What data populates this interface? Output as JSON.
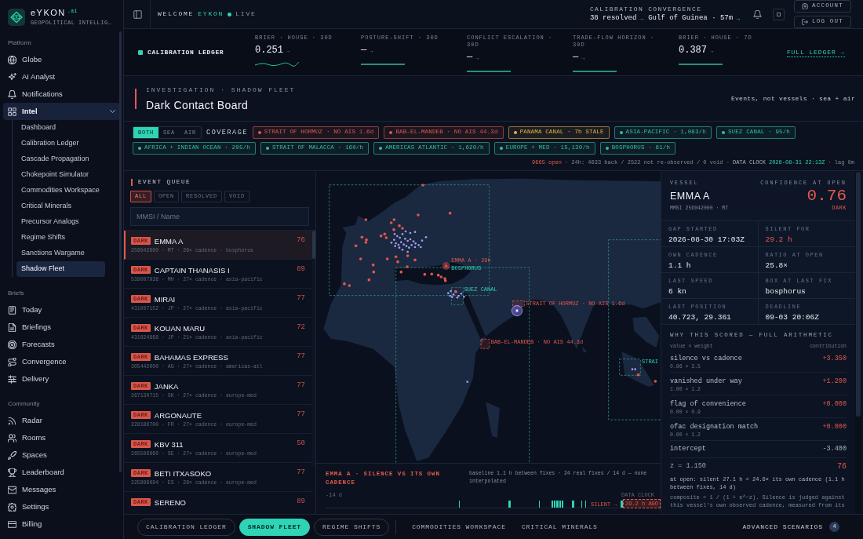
{
  "sidebar": {
    "brand": "eYKON",
    "brand_suffix": ".ai",
    "tagline": "GEOPOLITICAL INTELLIG…",
    "sections": [
      {
        "title": "Platform",
        "items": [
          {
            "label": "Globe",
            "selected": false
          },
          {
            "label": "AI Analyst",
            "selected": false
          },
          {
            "label": "Notifications",
            "selected": false
          },
          {
            "label": "Intel",
            "selected": true,
            "expanded": true,
            "children": [
              {
                "label": "Dashboard",
                "selected": false
              },
              {
                "label": "Calibration Ledger",
                "selected": false
              },
              {
                "label": "Cascade Propagation",
                "selected": false
              },
              {
                "label": "Chokepoint Simulator",
                "selected": false
              },
              {
                "label": "Commodities Workspace",
                "selected": false
              },
              {
                "label": "Critical Minerals",
                "selected": false
              },
              {
                "label": "Precursor Analogs",
                "selected": false
              },
              {
                "label": "Regime Shifts",
                "selected": false
              },
              {
                "label": "Sanctions Wargame",
                "selected": false
              },
              {
                "label": "Shadow Fleet",
                "selected": true
              }
            ]
          }
        ]
      },
      {
        "title": "Briefs",
        "items": [
          {
            "label": "Today",
            "selected": false
          },
          {
            "label": "Briefings",
            "selected": false
          },
          {
            "label": "Forecasts",
            "selected": false
          },
          {
            "label": "Convergence",
            "selected": false
          },
          {
            "label": "Delivery",
            "selected": false
          }
        ]
      },
      {
        "title": "Community",
        "items": [
          {
            "label": "Radar",
            "selected": false
          },
          {
            "label": "Rooms",
            "selected": false
          },
          {
            "label": "Spaces",
            "selected": false
          },
          {
            "label": "Leaderboard",
            "selected": false
          },
          {
            "label": "Messages",
            "selected": false
          },
          {
            "label": "Settings",
            "selected": false
          },
          {
            "label": "Billing",
            "selected": false
          }
        ]
      }
    ]
  },
  "top_bar": {
    "greeting": "WELCOME",
    "user": "EYKON",
    "status": "LIVE",
    "stats": [
      {
        "label": "CALIBRATION",
        "value": "38 resolved",
        "arrow": "→"
      },
      {
        "label": "CONVERGENCE",
        "value": "Gulf of Guinea · 57m",
        "arrow": "→"
      }
    ],
    "account_button": "ACCOUNT",
    "logout_button": "LOG OUT"
  },
  "ledger": {
    "title": "CALIBRATION LEDGER",
    "metrics": [
      {
        "label": "BRIER · HOUSE · 30D",
        "value": "0.251",
        "arrow": "→",
        "kind": "trend"
      },
      {
        "label": "POSTURE-SHIFT · 30D",
        "value": "—",
        "arrow": "→",
        "kind": "flat"
      },
      {
        "label": "CONFLICT ESCALATION · 30D",
        "value": "—",
        "arrow": "→",
        "kind": "flat"
      },
      {
        "label": "TRADE-FLOW HORIZON · 30D",
        "value": "—",
        "arrow": "→",
        "kind": "flat"
      },
      {
        "label": "BRIER · HOUSE · 7D",
        "value": "0.387",
        "arrow": "→",
        "kind": "flat"
      }
    ],
    "link": "FULL LEDGER →"
  },
  "investigation": {
    "eyebrow": "INVESTIGATION · SHADOW FLEET",
    "title": "Dark Contact Board",
    "subtitle": "Events, not vessels · sea + air"
  },
  "coverage": {
    "modes": [
      {
        "label": "BOTH",
        "selected": true
      },
      {
        "label": "SEA",
        "selected": false
      },
      {
        "label": "AIR",
        "selected": false
      }
    ],
    "label": "COVERAGE",
    "chips": [
      {
        "text": "STRAIT OF HORMUZ · NO AIS 1.6d",
        "color": "#e0574c"
      },
      {
        "text": "BAB-EL-MANDEB · NO AIS 44.3d",
        "color": "#e0574c"
      },
      {
        "text": "PANAMA CANAL · 7h STALE",
        "color": "#e3b448"
      },
      {
        "text": "ASIA-PACIFIC · 1,083/h",
        "color": "#2fbfa5"
      },
      {
        "text": "SUEZ CANAL · 95/h",
        "color": "#2fbfa5"
      },
      {
        "text": "AFRICA + INDIAN OCEAN · 205/h",
        "color": "#2fbfa5"
      },
      {
        "text": "STRAIT OF MALACCA · 160/h",
        "color": "#2fbfa5"
      },
      {
        "text": "AMERICAS ATLANTIC · 1,620/h",
        "color": "#2fbfa5"
      },
      {
        "text": "EUROPE + MED · 15,130/h",
        "color": "#2fbfa5"
      },
      {
        "text": "BOSPHORUS · 61/h",
        "color": "#2fbfa5"
      }
    ]
  },
  "status_line": {
    "open": "9665 open",
    "summary": "· 24h: 4633 back / 2522 not re-observed / 0 void ·",
    "clock_label": "DATA CLOCK",
    "clock": "2026-08-31 22:13Z",
    "lag": "· lag 0m"
  },
  "event_queue": {
    "title": "EVENT QUEUE",
    "filters": [
      {
        "label": "ALL",
        "selected": true
      },
      {
        "label": "OPEN",
        "selected": false
      },
      {
        "label": "RESOLVED",
        "selected": false
      },
      {
        "label": "VOID",
        "selected": false
      }
    ],
    "search": {
      "placeholder": "MMSI / Name"
    },
    "events": [
      {
        "badge": "DARK",
        "name": "EMMA A",
        "meta": "256042000 · MT · 26× cadence · bosphorus",
        "score": "76",
        "selected": true
      },
      {
        "badge": "DARK",
        "name": "CAPTAIN THANASIS I",
        "meta": "538007938 · MH · 27× cadence · asia-pacific",
        "score": "89",
        "selected": false
      },
      {
        "badge": "DARK",
        "name": "MIRAI",
        "meta": "431007152 · JP · 27× cadence · asia-pacific",
        "score": "77",
        "selected": false
      },
      {
        "badge": "DARK",
        "name": "KOUAN MARU",
        "meta": "431024868 · JP · 21× cadence · asia-pacific",
        "score": "72",
        "selected": false
      },
      {
        "badge": "DARK",
        "name": "BAHAMAS EXPRESS",
        "meta": "305442000 · AG · 27× cadence · americas-atl",
        "score": "77",
        "selected": false
      },
      {
        "badge": "DARK",
        "name": "JANKA",
        "meta": "267130715 · SK · 27× cadence · europe-med",
        "score": "77",
        "selected": false
      },
      {
        "badge": "DARK",
        "name": "ARGONAUTE",
        "meta": "228186700 · FR · 27× cadence · europe-med",
        "score": "77",
        "selected": false
      },
      {
        "badge": "DARK",
        "name": "KBV 311",
        "meta": "265506960 · SE · 27× cadence · europe-med",
        "score": "50",
        "selected": false
      },
      {
        "badge": "DARK",
        "name": "BETI ITXASOKO",
        "meta": "225998094 · ES · 28× cadence · europe-med",
        "score": "77",
        "selected": false
      },
      {
        "badge": "DARK",
        "name": "SERENO",
        "score": "89",
        "selected": false
      }
    ]
  },
  "map": {
    "labels": [
      {
        "text": "EMMA A · 29h",
        "kind": "alert"
      },
      {
        "text": "BOSPHORUS",
        "kind": "zone"
      },
      {
        "text": "SUEZ CANAL",
        "kind": "zone"
      },
      {
        "text": "STRAIT OF HORMUZ · NO AIS 1.6d",
        "kind": "alert"
      },
      {
        "text": "BAB-EL-MANDEB · NO AIS 44.3d",
        "kind": "alert"
      },
      {
        "text": "STRAI",
        "kind": "zone"
      }
    ]
  },
  "timeline": {
    "title": "EMMA A · SILENCE VS ITS OWN CADENCE",
    "note": "baseline 1.1 h between fixes · 24 real fixes / 14 d — none interpolated",
    "start_label": "-14 d",
    "end_label": "DATA CLOCK",
    "silent_label": "SILENT →",
    "gap_label": "29.2 h AGO"
  },
  "vessel": {
    "label": "VESSEL",
    "name": "EMMA A",
    "mmsi": "MMSI 256042000 · MT",
    "confidence_label": "CONFIDENCE AT OPEN",
    "confidence": "0.76",
    "verdict": "DARK",
    "facts": [
      {
        "label": "GAP STARTED",
        "value": "2026-08-30 17:03Z",
        "alert": false
      },
      {
        "label": "SILENT FOR",
        "value": "29.2 h",
        "alert": true
      },
      {
        "label": "OWN CADENCE",
        "value": "1.1 h",
        "alert": false
      },
      {
        "label": "RATIO AT OPEN",
        "value": "25.8×",
        "alert": false
      },
      {
        "label": "LAST SPEED",
        "value": "6 kn",
        "alert": false
      },
      {
        "label": "BOX AT LAST FIX",
        "value": "bosphorus",
        "alert": false
      },
      {
        "label": "LAST POSITION",
        "value": "40.723, 29.361",
        "alert": false
      },
      {
        "label": "DEADLINE",
        "value": "09-03 20:06Z",
        "alert": false
      }
    ]
  },
  "arithmetic": {
    "title": "WHY THIS SCORED — FULL ARITHMETIC",
    "left_header": "value × weight",
    "right_header": "contribution",
    "terms": [
      {
        "kind": "weighted",
        "name": "silence vs cadence",
        "formula": "0.96 × 3.5",
        "contribution": "+3.350"
      },
      {
        "kind": "weighted",
        "name": "vanished under way",
        "formula": "1.00 × 1.2",
        "contribution": "+1.200"
      },
      {
        "kind": "weighted",
        "name": "flag of convenience",
        "formula": "0.00 × 0.9",
        "contribution": "+0.000"
      },
      {
        "kind": "weighted",
        "name": "ofac designation match",
        "formula": "0.00 × 1.2",
        "contribution": "+0.000"
      },
      {
        "kind": "intercept",
        "name": "intercept",
        "contribution": "-3.400"
      }
    ],
    "z": "z = 1.150",
    "score": "76",
    "note": "at open: silent 27.1 h = 24.6× its own cadence (1.1 h between fixes, 14 d)",
    "footnote": "composite = 1 / (1 + e^−z). Silence is judged against this vessel's own observed cadence, measured from its"
  },
  "bottom_nav": {
    "tabs": [
      {
        "label": "CALIBRATION LEDGER",
        "kind": "pinned",
        "selected": false
      },
      {
        "label": "SHADOW FLEET",
        "kind": "pinned",
        "selected": true
      },
      {
        "label": "REGIME SHIFTS",
        "kind": "pinned",
        "selected": false
      },
      {
        "label": "COMMODITIES WORKSPACE",
        "kind": "recent",
        "selected": false
      },
      {
        "label": "CRITICAL MINERALS",
        "kind": "recent",
        "selected": false
      }
    ],
    "advanced": {
      "label": "ADVANCED SCENARIOS",
      "count": "4"
    }
  }
}
